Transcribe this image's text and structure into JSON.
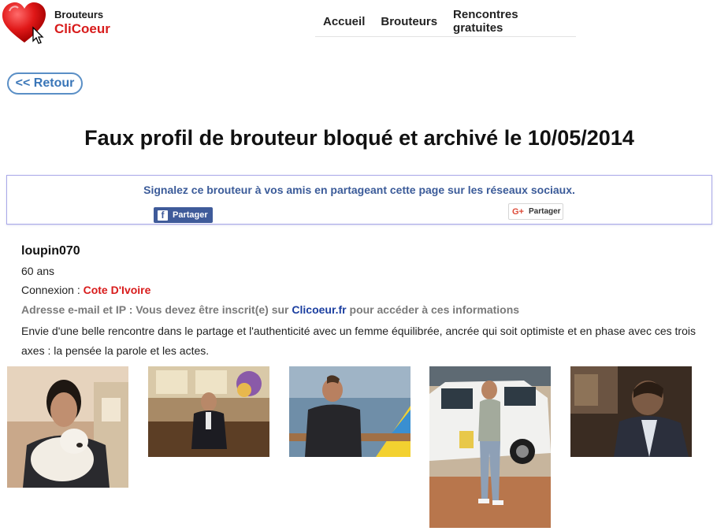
{
  "header": {
    "brand_line1": "Brouteurs",
    "brand_cli": "Cli",
    "brand_coeur": "Coeur",
    "nav": [
      "Accueil",
      "Brouteurs",
      "Rencontres gratuites"
    ]
  },
  "back_label": "<< Retour",
  "page_title": "Faux profil de brouteur bloqué et archivé le 10/05/2014",
  "share": {
    "text": "Signalez ce brouteur à vos amis en partageant cette page sur les réseaux sociaux.",
    "facebook_label": "Partager",
    "google_label": "Partager"
  },
  "profile": {
    "username": "loupin070",
    "age": "60 ans",
    "connexion_label": "Connexion : ",
    "country": "Cote D'Ivoire",
    "email_prefix": "Adresse e-mail et IP : Vous devez être inscrit(e) sur ",
    "email_site": "Clicoeur.fr",
    "email_suffix": " pour accéder à ces informations",
    "description": "Envie d'une belle rencontre dans le partage et l'authenticité avec un femme équilibrée, ancrée qui soit optimiste et en phase avec ces trois axes : la pensée la parole et les actes."
  },
  "colors": {
    "brand_red": "#d81b1b",
    "share_blue": "#3b5b99",
    "facebook": "#3f5b9a",
    "link_blue": "#1c3fa0",
    "back_border": "#5a8fc6"
  },
  "photos": [
    "photo-man-with-dog",
    "photo-man-seated-lobby",
    "photo-man-on-boat",
    "photo-man-by-suv",
    "photo-man-in-suit"
  ]
}
